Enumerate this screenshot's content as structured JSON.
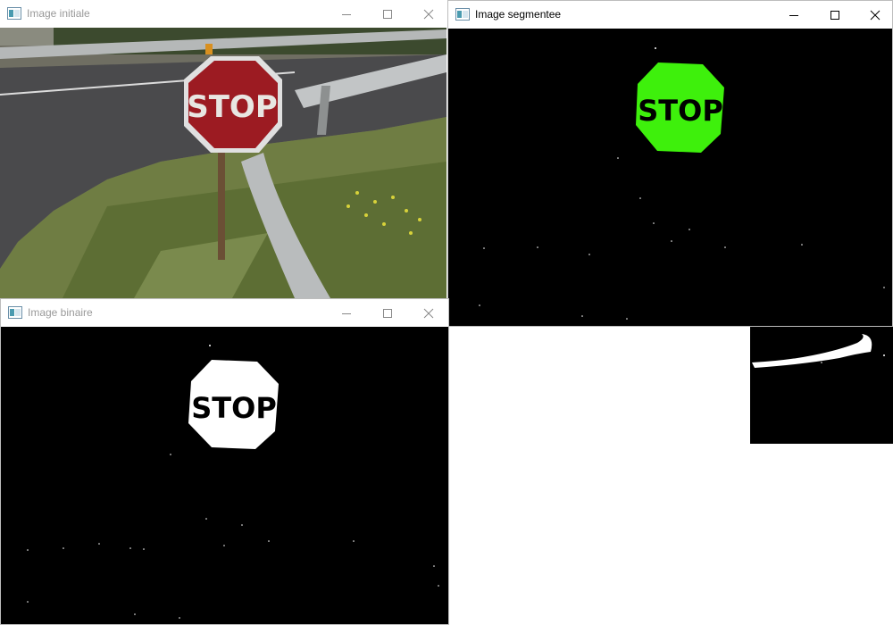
{
  "windows": {
    "initiale": {
      "title": "Image initiale",
      "sign_text": "STOP"
    },
    "segmentee": {
      "title": "Image segmentee",
      "sign_text": "STOP"
    },
    "binaire": {
      "title": "Image binaire",
      "sign_text": "STOP"
    }
  },
  "titlebar_controls": {
    "minimize_icon": "minimize-icon",
    "maximize_icon": "maximize-icon",
    "close_icon": "close-icon"
  },
  "colors": {
    "segment_green": "#3ef00c",
    "sign_red": "#9c1b22",
    "title_inactive": "#999999",
    "title_active": "#000000"
  }
}
